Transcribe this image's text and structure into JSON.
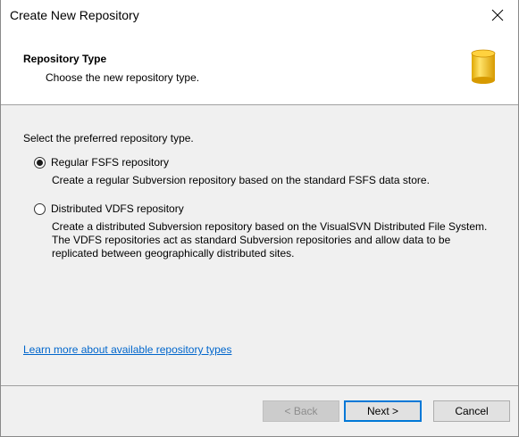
{
  "window": {
    "title": "Create New Repository"
  },
  "header": {
    "title": "Repository Type",
    "subtitle": "Choose the new repository type.",
    "icon": "database-cylinder-icon"
  },
  "main": {
    "prompt": "Select the preferred repository type.",
    "options": [
      {
        "label": "Regular FSFS repository",
        "description": "Create a regular Subversion repository based on the standard FSFS data store.",
        "checked": true
      },
      {
        "label": "Distributed VDFS repository",
        "description": "Create a distributed Subversion repository based on the VisualSVN Distributed File System. The VDFS repositories act as standard Subversion repositories and allow data to be replicated between geographically distributed sites.",
        "checked": false
      }
    ],
    "learn_more_link": "Learn more about available repository types"
  },
  "footer": {
    "back_label": "< Back",
    "next_label": "Next >",
    "cancel_label": "Cancel"
  },
  "colors": {
    "accent": "#0078d7",
    "link": "#0066cc",
    "icon_fill": "#f5c518"
  }
}
